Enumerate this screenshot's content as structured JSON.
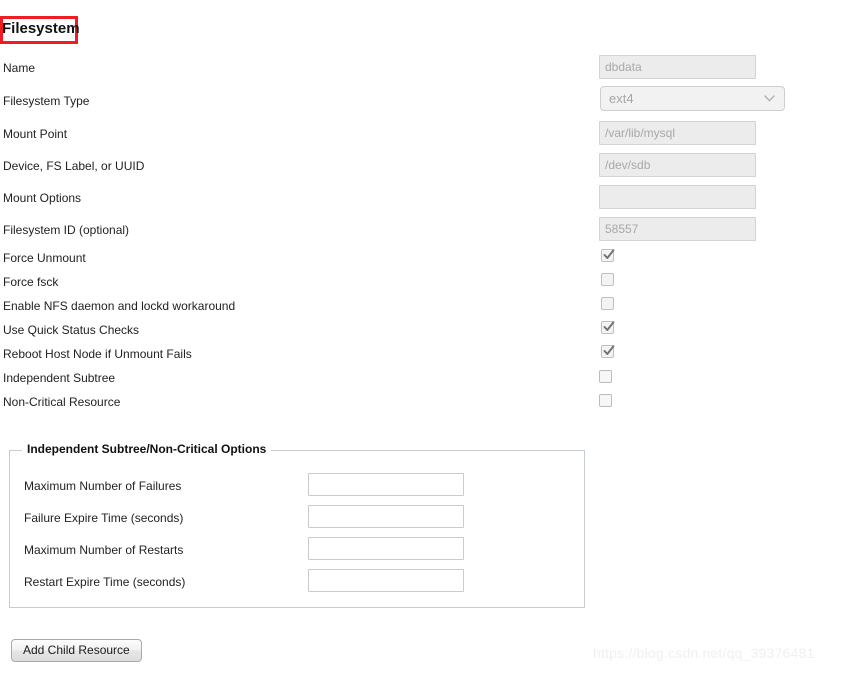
{
  "page": {
    "title": "Filesystem",
    "annotation_color": "#ef1c24"
  },
  "form": {
    "fields": [
      {
        "label": "Name",
        "value": "dbdata",
        "type": "text"
      },
      {
        "label": "Filesystem Type",
        "value": "ext4",
        "type": "select"
      },
      {
        "label": "Mount Point",
        "value": "/var/lib/mysql",
        "type": "text"
      },
      {
        "label": "Device, FS Label, or UUID",
        "value": "/dev/sdb",
        "type": "text"
      },
      {
        "label": "Mount Options",
        "value": "",
        "type": "text"
      },
      {
        "label": "Filesystem ID (optional)",
        "value": "58557",
        "type": "text"
      }
    ],
    "checkboxes": [
      {
        "label": "Force Unmount",
        "checked": true
      },
      {
        "label": "Force fsck",
        "checked": false
      },
      {
        "label": "Enable NFS daemon and lockd workaround",
        "checked": false
      },
      {
        "label": "Use Quick Status Checks",
        "checked": true
      },
      {
        "label": "Reboot Host Node if Unmount Fails",
        "checked": true
      },
      {
        "label": "Independent Subtree",
        "checked": false
      },
      {
        "label": "Non-Critical Resource",
        "checked": false
      }
    ]
  },
  "fieldset": {
    "legend": "Independent Subtree/Non-Critical Options",
    "fields": [
      {
        "label": "Maximum Number of Failures",
        "value": ""
      },
      {
        "label": "Failure Expire Time (seconds)",
        "value": ""
      },
      {
        "label": "Maximum Number of Restarts",
        "value": ""
      },
      {
        "label": "Restart Expire Time (seconds)",
        "value": ""
      }
    ]
  },
  "actions": {
    "add_child_resource": "Add Child Resource"
  },
  "watermark": {
    "text": "https://blog.csdn.net/qq_39376481"
  },
  "icons": {
    "chevron_down": "chevron-down-icon",
    "checkmark": "checkmark-icon"
  }
}
